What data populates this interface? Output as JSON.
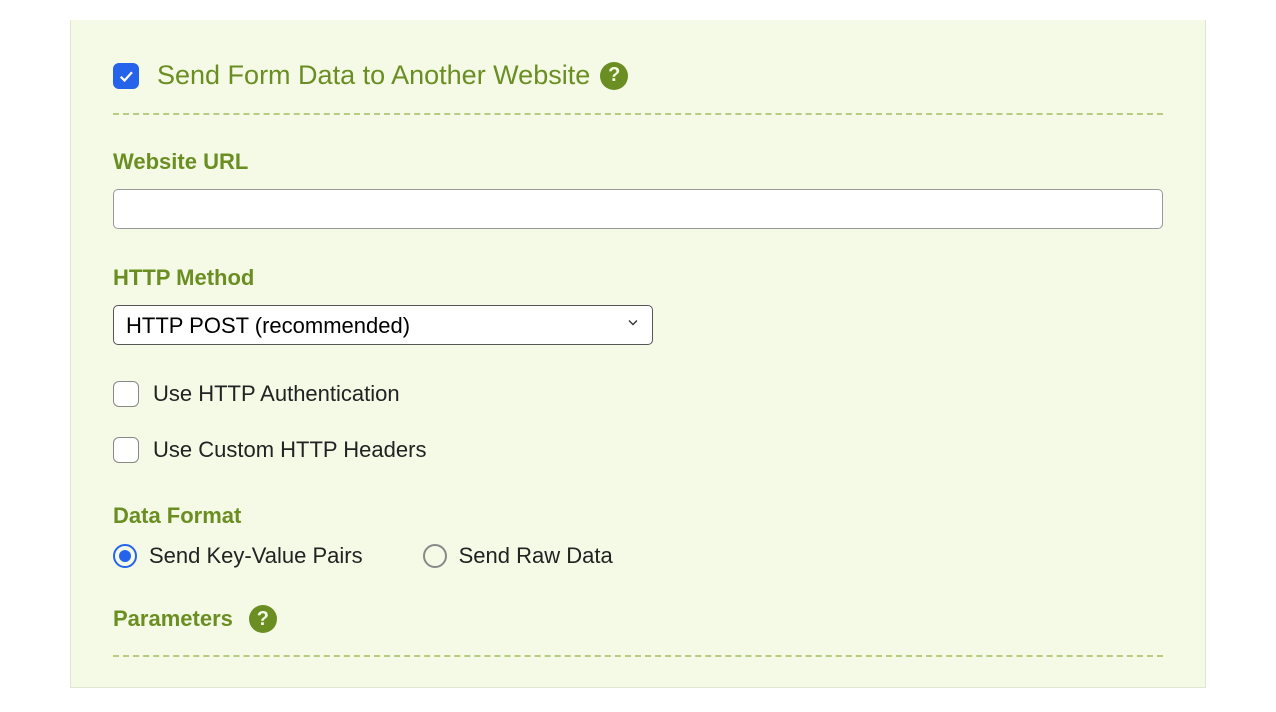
{
  "header": {
    "title": "Send Form Data to Another Website",
    "checked": true
  },
  "fields": {
    "website_url": {
      "label": "Website URL",
      "value": ""
    },
    "http_method": {
      "label": "HTTP Method",
      "selected": "HTTP POST (recommended)"
    },
    "use_http_auth": {
      "label": "Use HTTP Authentication",
      "checked": false
    },
    "use_custom_headers": {
      "label": "Use Custom HTTP Headers",
      "checked": false
    },
    "data_format": {
      "label": "Data Format",
      "options": {
        "kv": "Send Key-Value Pairs",
        "raw": "Send Raw Data"
      },
      "selected": "kv"
    },
    "parameters": {
      "label": "Parameters"
    }
  }
}
